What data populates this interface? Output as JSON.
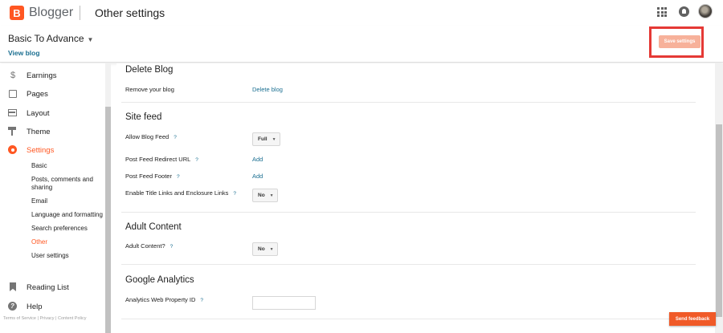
{
  "header": {
    "brand": "Blogger",
    "page_title": "Other settings",
    "icons": [
      "apps-icon",
      "notifications-icon",
      "account-avatar"
    ]
  },
  "blog": {
    "name": "Basic To Advance",
    "view_blog": "View blog",
    "save_label": "Save settings"
  },
  "sidebar": {
    "items": [
      {
        "label": "Earnings",
        "icon": "dollar-icon"
      },
      {
        "label": "Pages",
        "icon": "pages-icon"
      },
      {
        "label": "Layout",
        "icon": "layout-icon"
      },
      {
        "label": "Theme",
        "icon": "theme-icon"
      },
      {
        "label": "Settings",
        "icon": "gear-icon",
        "active": true
      }
    ],
    "sub_items": [
      {
        "label": "Basic"
      },
      {
        "label": "Posts, comments and sharing"
      },
      {
        "label": "Email"
      },
      {
        "label": "Language and formatting"
      },
      {
        "label": "Search preferences"
      },
      {
        "label": "Other",
        "active": true
      },
      {
        "label": "User settings"
      }
    ],
    "bottom_items": [
      {
        "label": "Reading List",
        "icon": "bookmark-icon"
      },
      {
        "label": "Help",
        "icon": "help-icon"
      }
    ],
    "footer": {
      "terms": "Terms of Service",
      "privacy": "Privacy",
      "content_policy": "Content Policy",
      "sep": "|"
    }
  },
  "main": {
    "help_mark": "?",
    "delete_blog": {
      "title": "Delete Blog",
      "remove_label": "Remove your blog",
      "action": "Delete blog"
    },
    "site_feed": {
      "title": "Site feed",
      "allow_label": "Allow Blog Feed",
      "allow_value": "Full",
      "redirect_label": "Post Feed Redirect URL",
      "redirect_action": "Add",
      "footer_label": "Post Feed Footer",
      "footer_action": "Add",
      "title_links_label": "Enable Title Links and Enclosure Links",
      "title_links_value": "No"
    },
    "adult_content": {
      "title": "Adult Content",
      "label": "Adult Content?",
      "value": "No"
    },
    "analytics": {
      "title": "Google Analytics",
      "label": "Analytics Web Property ID",
      "value": ""
    }
  },
  "feedback": {
    "label": "Send feedback"
  },
  "colors": {
    "accent": "#ff5722",
    "link": "#1b6f91",
    "highlight": "#e53935"
  }
}
